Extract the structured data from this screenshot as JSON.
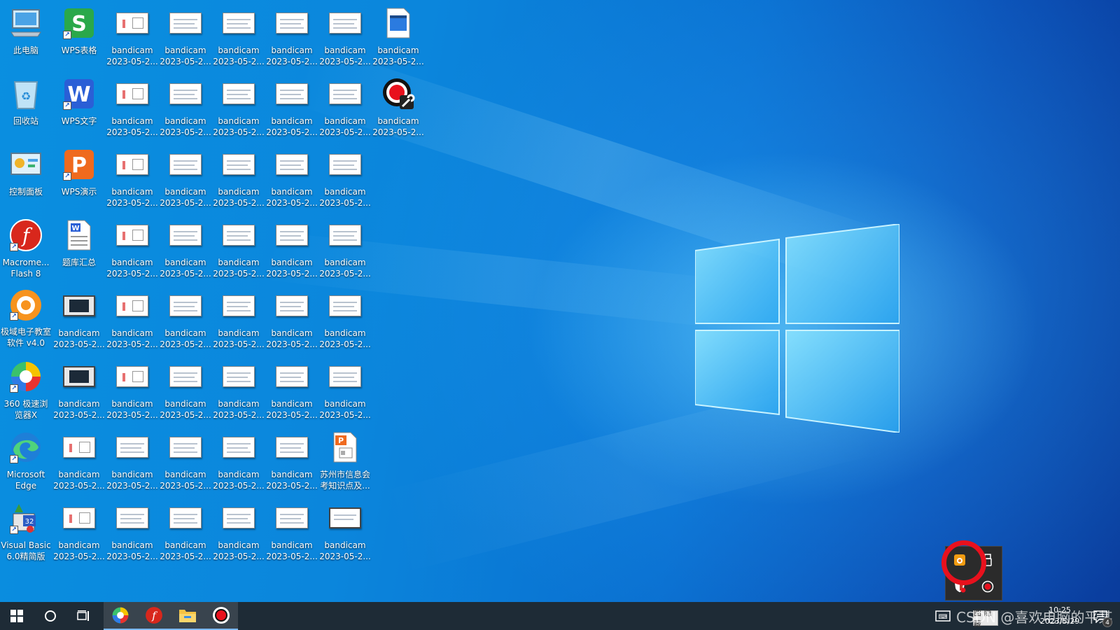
{
  "desktop": {
    "col1": [
      {
        "label": "此电脑",
        "icon": "computer-icon"
      },
      {
        "label": "回收站",
        "icon": "recycle-bin-icon"
      },
      {
        "label": "控制面板",
        "icon": "control-panel-icon"
      },
      {
        "label": "Macrome...\nFlash 8",
        "icon": "flash-icon"
      },
      {
        "label": "极域电子教室\n软件 v4.0 2...",
        "icon": "jiyu-classroom-icon"
      },
      {
        "label": "360 极速浏\n览器X",
        "icon": "360-browser-icon"
      },
      {
        "label": "Microsoft\nEdge",
        "icon": "edge-icon"
      },
      {
        "label": "Visual Basic\n6.0精简版",
        "icon": "visual-basic-icon"
      }
    ],
    "col2": [
      {
        "label": "WPS表格",
        "icon": "wps-spreadsheet-icon"
      },
      {
        "label": "WPS文字",
        "icon": "wps-writer-icon"
      },
      {
        "label": "WPS演示",
        "icon": "wps-presentation-icon"
      },
      {
        "label": "题库汇总",
        "icon": "word-document-icon"
      },
      {
        "label": "bandicam\n2023-05-2...",
        "icon": "video-thumbnail-icon"
      },
      {
        "label": "bandicam\n2023-05-2...",
        "icon": "video-thumbnail-icon"
      },
      {
        "label": "bandicam\n2023-05-2...",
        "icon": "image-thumbnail-icon"
      },
      {
        "label": "bandicam\n2023-05-2...",
        "icon": "image-thumbnail-icon"
      }
    ],
    "bandicam_label": "bandicam\n2023-05-2...",
    "col7_row1": {
      "label": "bandicam\n2023-05-2...",
      "icon": "video-file-icon"
    },
    "col7_row2": {
      "label": "bandicam\n2023-05-2...",
      "icon": "bandicam-icon"
    },
    "col6_row7": {
      "label": "苏州市信息会\n考知识点及...",
      "icon": "wps-ppt-file-icon"
    }
  },
  "tray_popup": {
    "items": [
      "bandicam-tray-icon",
      "usb-device-icon",
      "security-shield-icon",
      "record-icon"
    ]
  },
  "taskbar": {
    "clock_time": "10:25",
    "clock_date": "2023/5/29",
    "ime_label": "图 隐藏",
    "watermark": "CSDN @喜欢电脑的平某",
    "notification_count": "4"
  },
  "colors": {
    "taskbar": "#1e2b36",
    "highlight_ring": "#e8111d"
  }
}
